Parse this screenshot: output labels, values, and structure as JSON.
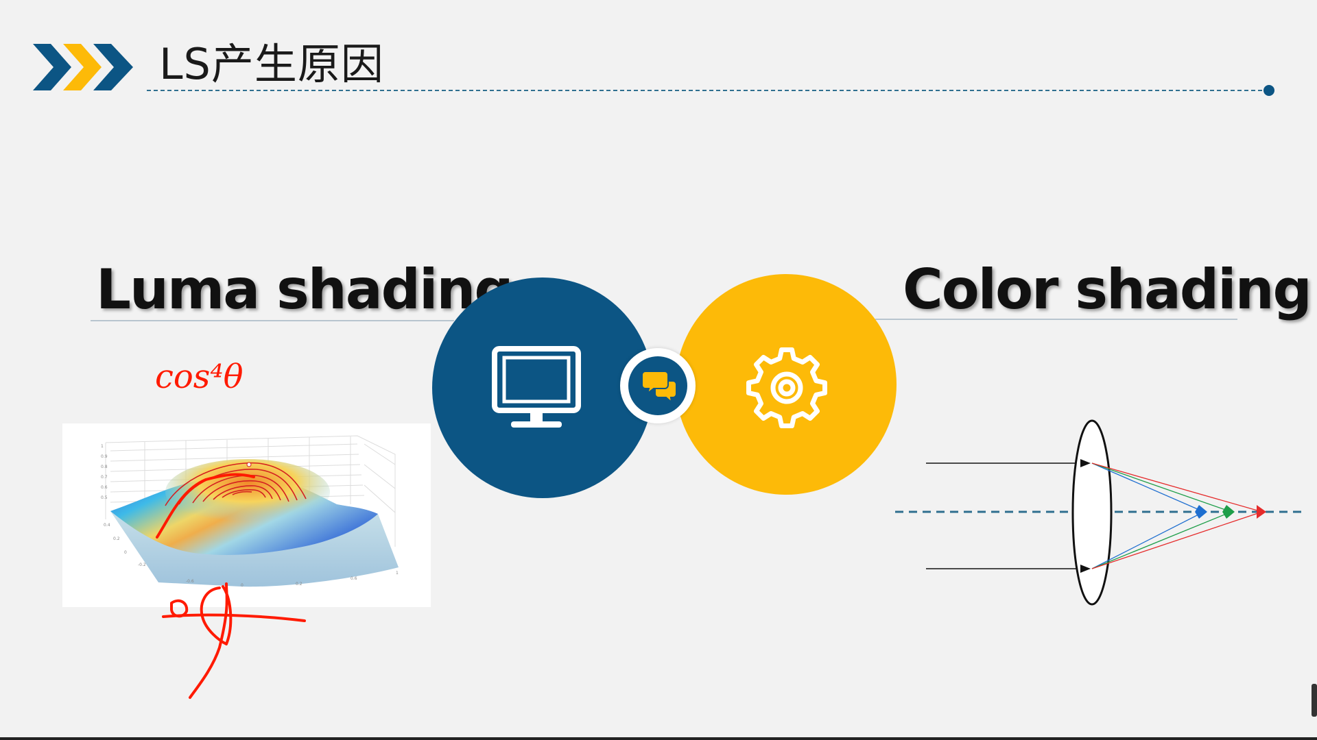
{
  "slide": {
    "title": "LS产生原因"
  },
  "sections": {
    "luma": {
      "title": "Luma shading"
    },
    "color": {
      "title": "Color shading"
    }
  },
  "annotations": {
    "handwritten_formula": "cos⁴θ"
  },
  "icons": {
    "header": "chevron-arrows-icon",
    "left_circle": "monitor-icon",
    "center_circle": "chat-bubbles-icon",
    "right_circle": "gear-icon"
  },
  "colors": {
    "primary_blue": "#0c5584",
    "accent_yellow": "#fdba08",
    "annotation_red": "#ff1a00",
    "background": "#f2f2f2"
  }
}
